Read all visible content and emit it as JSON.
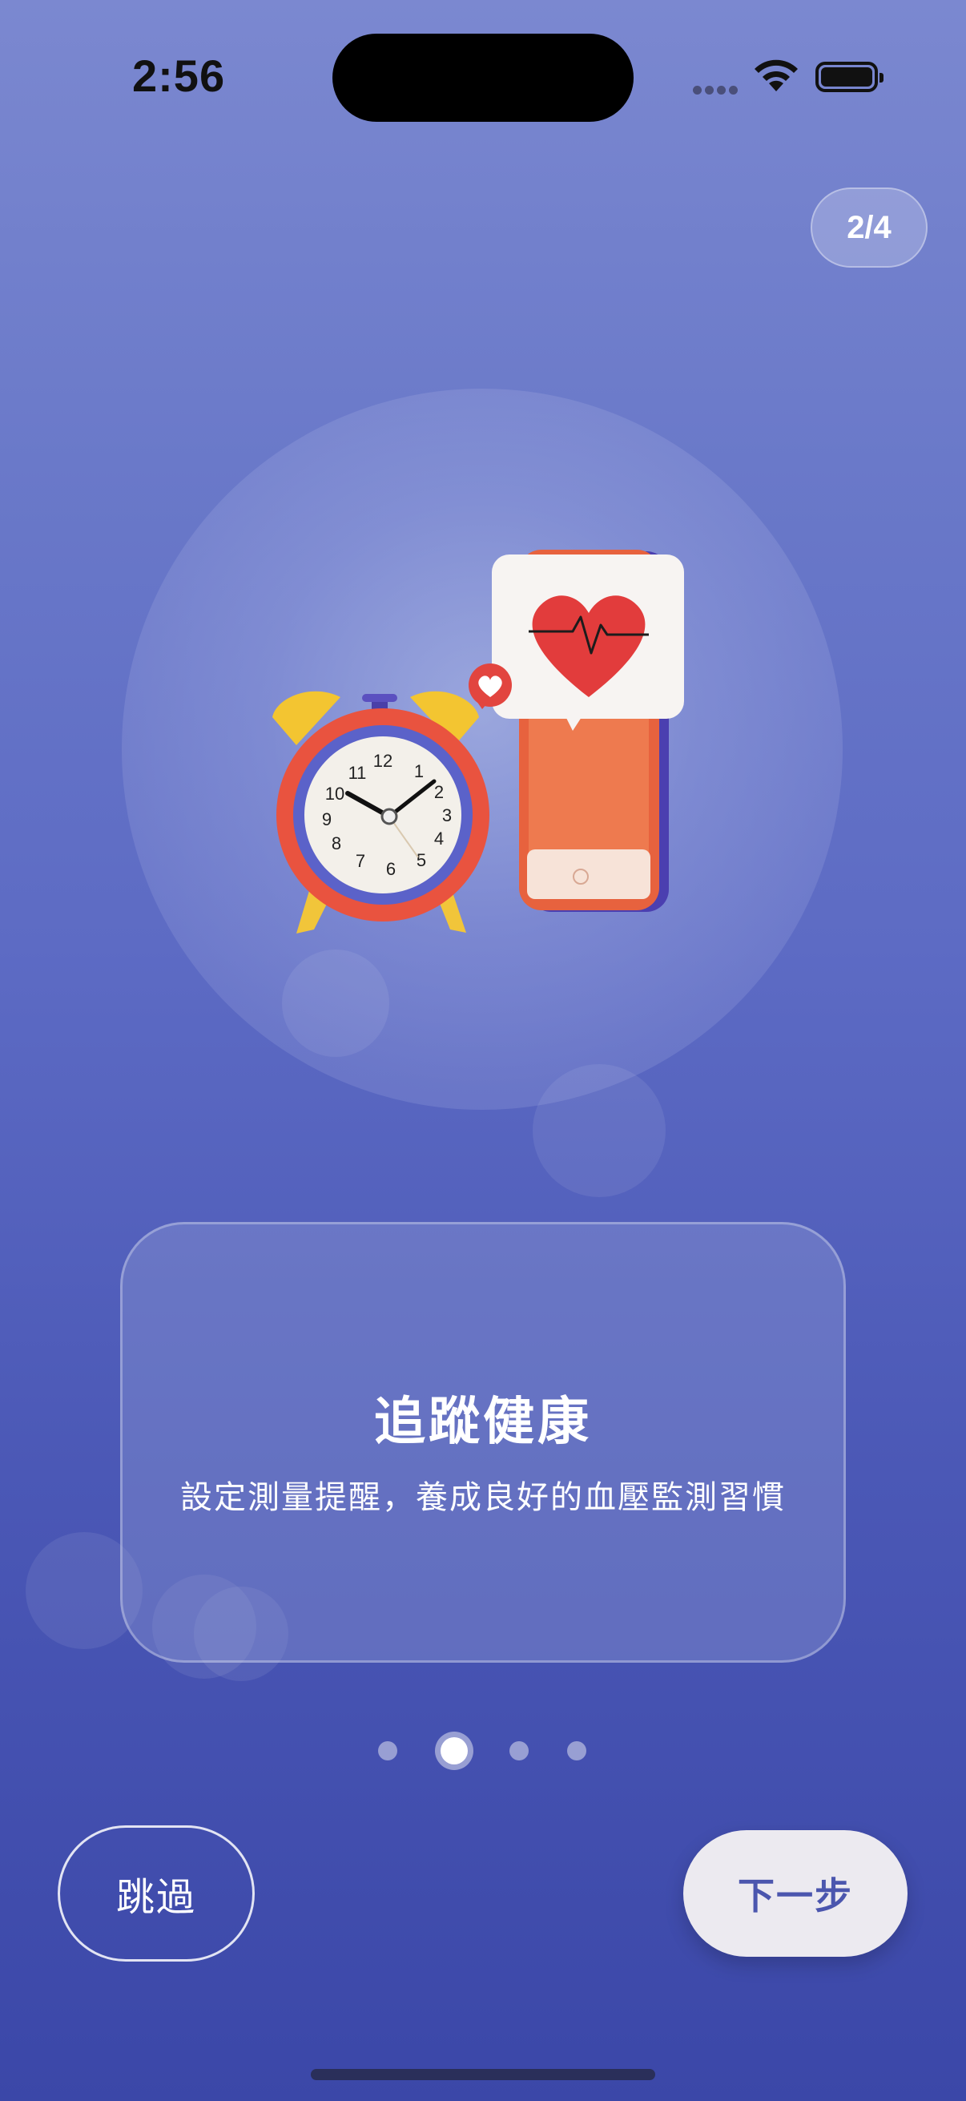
{
  "status_bar": {
    "time": "2:56"
  },
  "step_indicator": {
    "text": "2/4"
  },
  "card": {
    "title": "追蹤健康",
    "subtitle": "設定測量提醒，養成良好的血壓監測習慣"
  },
  "pager": {
    "total": 4,
    "active_index": 1
  },
  "buttons": {
    "skip_label": "跳過",
    "next_label": "下一步"
  },
  "illustration": {
    "icons": [
      "alarm-clock-icon",
      "phone-icon",
      "heart-pulse-icon",
      "heart-notification-icon"
    ]
  },
  "colors": {
    "background_top": "#7b88d0",
    "background_bottom": "#3b47a8",
    "accent": "#4b56ae",
    "heart": "#e23c3c",
    "clock_body": "#e9533f",
    "clock_bells": "#f3c531"
  }
}
